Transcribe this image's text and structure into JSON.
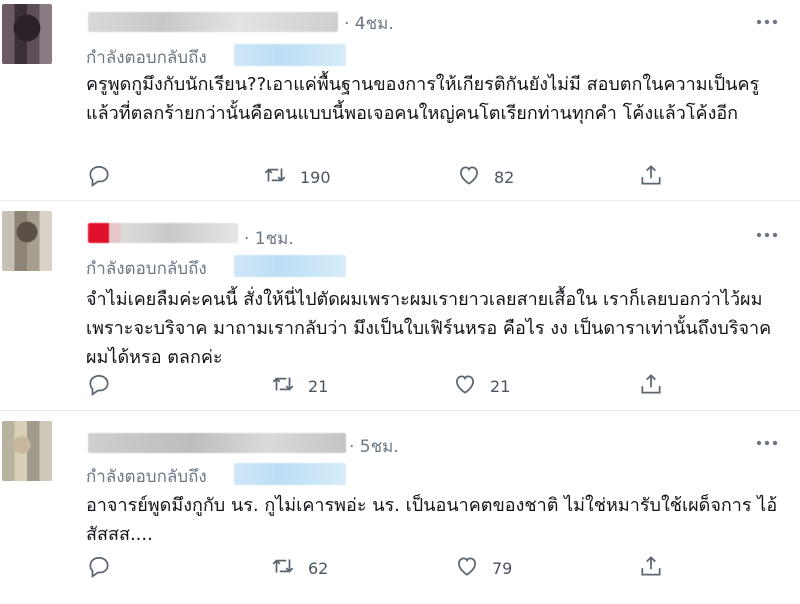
{
  "reply_prefix": "กำลังตอบกลับถึง",
  "icons": {
    "more": "more-horizontal-icon",
    "reply": "reply-icon",
    "retweet": "retweet-icon",
    "like": "heart-icon",
    "share": "share-icon"
  },
  "colors": {
    "muted_text": "#6b7785",
    "mention_blur": "#bcdff5",
    "divider": "#e6ecf0"
  },
  "tweets": [
    {
      "time": "· 4ชม.",
      "body": "ครูพูดกูมึงกับนักเรียน??เอาแค่พื้นฐานของการให้เกียรติกันยังไม่มี สอบตกในความเป็นครู แล้วที่ตลกร้ายกว่านั้นคือคนแบบนี้พอเจอคนใหญ่คนโตเรียกท่านทุกคำ โค้งแล้วโค้งอีก",
      "retweets": "190",
      "likes": "82"
    },
    {
      "time": "· 1ชม.",
      "body": "จำไม่เคยลืมค่ะคนนี้ สั่งให้นี่ไปตัดผมเพราะผมเรายาวเลยสายเสื้อใน เราก็เลยบอกว่าไว้ผมเพราะจะบริจาค มาถามเรากลับว่า มึงเป็นใบเฟิร์นหรอ คือไร งง เป็นดาราเท่านั้นถึงบริจาคผมได้หรอ ตลกค่ะ",
      "retweets": "21",
      "likes": "21"
    },
    {
      "time": "· 5ชม.",
      "body": "อาจารย์พูดมึงกูกับ นร. กูไม่เคารพอ่ะ นร. เป็นอนาคตของชาติ ไม่ใช่หมารับใช้เผด็จการ ไอ้สัสสส....",
      "retweets": "62",
      "likes": "79"
    }
  ]
}
